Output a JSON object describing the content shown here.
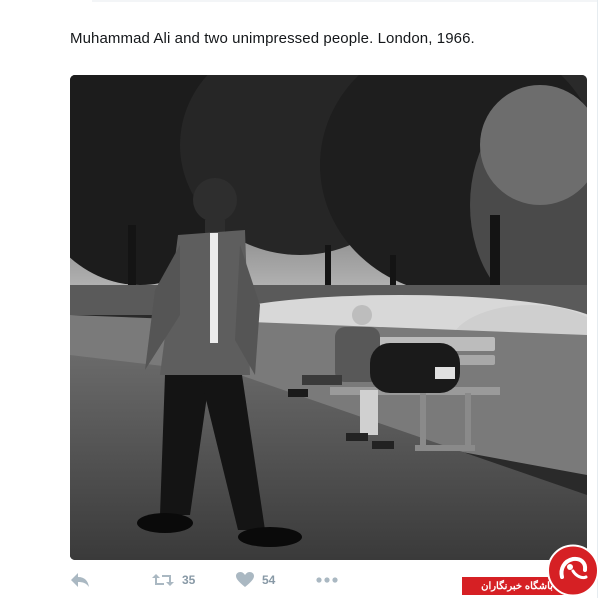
{
  "tweet": {
    "text": "Muhammad Ali and two unimpressed people. London, 1966."
  },
  "photo": {
    "description_icon": "photo-icon"
  },
  "actions": {
    "reply_icon": "reply-icon",
    "retweet_icon": "retweet-icon",
    "retweet_count": "35",
    "like_icon": "heart-icon",
    "like_count": "54",
    "more_icon": "more-dots-icon"
  },
  "watermark": {
    "text": "باشگاه خبرنگاران",
    "color": "#d62024"
  }
}
